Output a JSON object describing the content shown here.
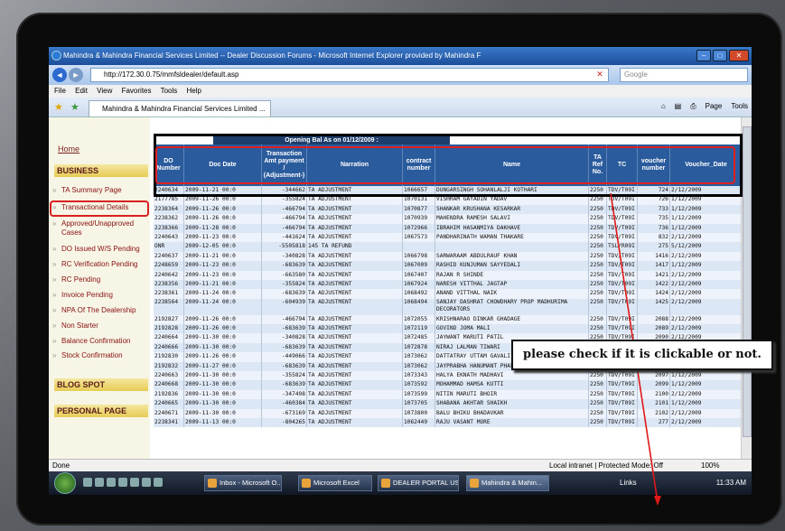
{
  "window": {
    "title": "Mahindra & Mahindra Financial Services Limited -- Dealer Discussion Forums - Microsoft Internet Explorer provided by Mahindra F",
    "url": "http://172.30.0.75/mmfsldealer/default.asp",
    "search_placeholder": "Google"
  },
  "menu": [
    "File",
    "Edit",
    "View",
    "Favorites",
    "Tools",
    "Help"
  ],
  "tab": {
    "label": "Mahindra & Mahindra Financial Services Limited ..."
  },
  "toolbar": {
    "page_label": "Page",
    "tools_label": "Tools"
  },
  "sidebar": {
    "home": "Home",
    "business_heading": "BUSINESS",
    "items": [
      "TA Summary Page",
      "Transactional Details",
      "Approved/Unapproved Cases",
      "DO Issued W/S Pending",
      "RC Verification Pending",
      "RC Pending",
      "Invoice Pending",
      "NPA Of The Dealership",
      "Non Starter",
      "Balance Confirmation",
      "Stock Confirmation"
    ],
    "blog_heading": "BLOG SPOT",
    "personal_heading": "PERSONAL PAGE"
  },
  "table": {
    "opening_text": "Opening Bal As on 01/12/2009 :",
    "headers": [
      "DO Number",
      "Doc Date",
      "Transaction Amt payment / (Adjustment-)",
      "Narration",
      "contract number",
      "Name",
      "TA Ref No.",
      "TC",
      "voucher number",
      "Voucher_Date"
    ],
    "rows": [
      [
        "2240634",
        "2009-11-21 00:0",
        "-344662",
        "TA ADJUSTMENT",
        "1066657",
        "DUNGARSINGH SOHANLALJI KOTHARI",
        "2250",
        "TDV/T09I",
        "724",
        "2/12/2009"
      ],
      [
        "2177785",
        "2009-11-26 00:0",
        "-355824",
        "TA ADJUSTMENT",
        "1070131",
        "VISHRAM GAYADIN YADAV",
        "2250",
        "TDV/T09I",
        "726",
        "1/12/2009"
      ],
      [
        "2238364",
        "2009-11-26 00:0",
        "-466794",
        "TA ADJUSTMENT",
        "1070877",
        "SHANKAR KRUSHANA KESARKAR",
        "2250",
        "TDV/T09I",
        "733",
        "1/12/2009"
      ],
      [
        "2238362",
        "2009-11-26 00:0",
        "-466794",
        "TA ADJUSTMENT",
        "1070939",
        "MAHENDRA RAMESH SALAVI",
        "2250",
        "TDV/T09I",
        "735",
        "1/12/2009"
      ],
      [
        "2238366",
        "2009-11-28 00:0",
        "-466794",
        "TA ADJUSTMENT",
        "1072966",
        "IBRAHIM HASANMIYA DAKHAVE",
        "2250",
        "TDV/T09I",
        "736",
        "1/12/2009"
      ],
      [
        "2240643",
        "2009-11-23 00:0",
        "-441624",
        "TA ADJUSTMENT",
        "1067573",
        "PANDHARINATH WAMAN THAKARE",
        "2250",
        "TDV/T09I",
        "832",
        "2/12/2009"
      ],
      [
        "ONR",
        "2009-12-05 00:0",
        "-5505818",
        "145 TA REFUND",
        "",
        "",
        "2250",
        "TSL/R09I",
        "275",
        "5/12/2009"
      ],
      [
        "2240637",
        "2009-11-21 00:0",
        "-340828",
        "TA ADJUSTMENT",
        "1066798",
        "SARWARAAM ABDULRAUF KHAN",
        "2250",
        "TDV/T09I",
        "1416",
        "2/12/2009"
      ],
      [
        "2248659",
        "2009-11-23 00:0",
        "-683639",
        "TA ADJUSTMENT",
        "1067009",
        "RASHID KUNJUMAN SAYYEDALI",
        "2250",
        "TDV/T09I",
        "1417",
        "1/12/2009"
      ],
      [
        "2240642",
        "2009-11-23 00:0",
        "-663580",
        "TA ADJUSTMENT",
        "1067407",
        "RAJAN R SHINDE",
        "2250",
        "TDV/T09I",
        "1421",
        "2/12/2009"
      ],
      [
        "2238356",
        "2009-11-21 00:0",
        "-355824",
        "TA ADJUSTMENT",
        "1067924",
        "NARESH VITTHAL JAGTAP",
        "2250",
        "TDV/T09I",
        "1422",
        "2/12/2009"
      ],
      [
        "2238361",
        "2009-11-24 00:0",
        "-683639",
        "TA ADJUSTMENT",
        "1068492",
        "ANAND VITTHAL NAIK",
        "2250",
        "TDV/T09I",
        "1424",
        "2/12/2009"
      ],
      [
        "2238564",
        "2009-11-24 00:0",
        "-604939",
        "TA ADJUSTMENT",
        "1068494",
        "SANJAY DASHRAT CHOWDHARY PROP MADHURIMA DECORATORS",
        "2250",
        "TDV/T09I",
        "1425",
        "2/12/2009"
      ],
      [
        "2192827",
        "2009-11-26 00:0",
        "-466794",
        "TA ADJUSTMENT",
        "1072055",
        "KRISHNARAO DINKAR GHADAGE",
        "2250",
        "TDV/T09I",
        "2088",
        "2/12/2009"
      ],
      [
        "2192828",
        "2009-11-26 00:0",
        "-683639",
        "TA ADJUSTMENT",
        "1072119",
        "GOVIND JOMA MALI",
        "2250",
        "TDV/T09I",
        "2089",
        "2/12/2009"
      ],
      [
        "2240664",
        "2009-11-30 00:0",
        "-340828",
        "TA ADJUSTMENT",
        "1072485",
        "JAYWANT MARUTI PATIL",
        "2250",
        "TDV/T09I",
        "2090",
        "2/12/2009"
      ],
      [
        "2240666",
        "2009-11-30 00:0",
        "-683639",
        "TA ADJUSTMENT",
        "1072878",
        "NIRAJ LALMAN TIWARI",
        "2250",
        "TDV/T09I",
        "2092",
        "2/12/2009"
      ],
      [
        "2192830",
        "2009-11-26 00:0",
        "-449066",
        "TA ADJUSTMENT",
        "1073062",
        "DATTATRAY UTTAM GAVALI",
        "2250",
        "TDV/T09I",
        "2094",
        "2/12/2009"
      ],
      [
        "2192832",
        "2009-11-27 00:0",
        "-683639",
        "TA ADJUSTMENT",
        "1073062",
        "JAYPRABHA HANUMANT PHALLE",
        "2250",
        "TDV/T09I",
        "2095",
        "2/12/2009"
      ],
      [
        "2240663",
        "2009-11-30 00:0",
        "-355824",
        "TA ADJUSTMENT",
        "1073343",
        "HALYA EKNATH MADHAVI",
        "2250",
        "TDV/T09I",
        "2097",
        "1/12/2009"
      ],
      [
        "2240668",
        "2009-11-30 00:0",
        "-683639",
        "TA ADJUSTMENT",
        "1073592",
        "MOHAMMAD HAMSA KUTTI",
        "2250",
        "TDV/T09I",
        "2099",
        "1/12/2009"
      ],
      [
        "2192836",
        "2009-11-30 00:0",
        "-347498",
        "TA ADJUSTMENT",
        "1073599",
        "NITIN MARUTI BHOIR",
        "2250",
        "TDV/T09I",
        "2100",
        "2/12/2009"
      ],
      [
        "2240665",
        "2009-11-30 00:0",
        "-460384",
        "TA ADJUSTMENT",
        "1073705",
        "SHABANA AKHTAR SHAIKH",
        "2250",
        "TDV/T09I",
        "2101",
        "1/12/2009"
      ],
      [
        "2240671",
        "2009-11-30 00:0",
        "-673169",
        "TA ADJUSTMENT",
        "1073800",
        "BALU BHIKU BHADAVKAR",
        "2250",
        "TDV/T09I",
        "2102",
        "2/12/2009"
      ],
      [
        "2238341",
        "2009-11-13 00:0",
        "-804265",
        "TA ADJUSTMENT",
        "1062449",
        "RAJU VASANT MORE",
        "2250",
        "TDV/T09I",
        "277",
        "2/12/2009"
      ]
    ]
  },
  "callout": "please check if it is clickable or not.",
  "status": {
    "left": "Done",
    "zone": "Local intranet | Protected Mode: Off",
    "zoom": "100%"
  },
  "taskbar": {
    "items": [
      "Inbox - Microsoft O...",
      "Microsoft Excel",
      "DEALER PORTAL US...",
      "Mahindra & Mahin..."
    ],
    "links": "Links",
    "clock": "11:33 AM"
  }
}
